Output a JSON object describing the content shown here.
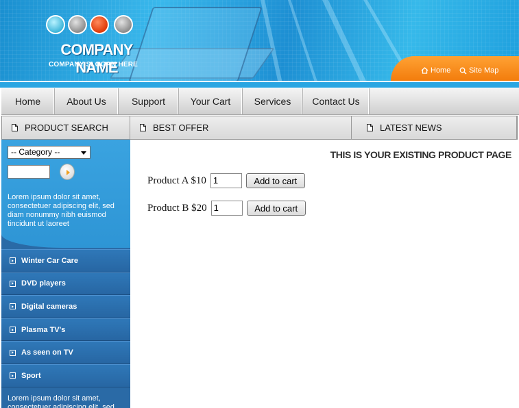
{
  "header": {
    "company_name": "COMPANY NAME",
    "company_slogan": "COMPANY SLOGAN HERE",
    "top_links": {
      "home": "Home",
      "site_map": "Site Map"
    },
    "colors": {
      "accent_orange": "#f27a0a",
      "accent_blue": "#2aa6e2"
    }
  },
  "nav": {
    "items": [
      {
        "label": "Home"
      },
      {
        "label": "About Us"
      },
      {
        "label": "Support"
      },
      {
        "label": "Your Cart"
      },
      {
        "label": "Services"
      },
      {
        "label": "Contact Us"
      }
    ]
  },
  "sections": {
    "product_search": "PRODUCT SEARCH",
    "best_offer": "BEST OFFER",
    "latest_news": "LATEST NEWS"
  },
  "sidebar": {
    "category_select": {
      "value": "-- Category --"
    },
    "search": {
      "value": ""
    },
    "lorem_top": "Lorem ipsum dolor sit amet, consectetuer adipiscing elit, sed diam nonummy nibh euismod tincidunt ut laoreet",
    "categories": [
      {
        "label": "Winter Car Care"
      },
      {
        "label": "DVD players"
      },
      {
        "label": "Digital cameras"
      },
      {
        "label": "Plasma TV's"
      },
      {
        "label": "As seen on TV"
      },
      {
        "label": "Sport"
      }
    ],
    "lorem_bottom": "Lorem ipsum dolor sit amet, consectetuer adipiscing elit, sed"
  },
  "main": {
    "heading": "THIS IS YOUR EXISTING PRODUCT PAGE",
    "products": [
      {
        "label": "Product A $10",
        "quantity": "1",
        "button": "Add to cart"
      },
      {
        "label": "Product B $20",
        "quantity": "1",
        "button": "Add to cart"
      }
    ]
  }
}
